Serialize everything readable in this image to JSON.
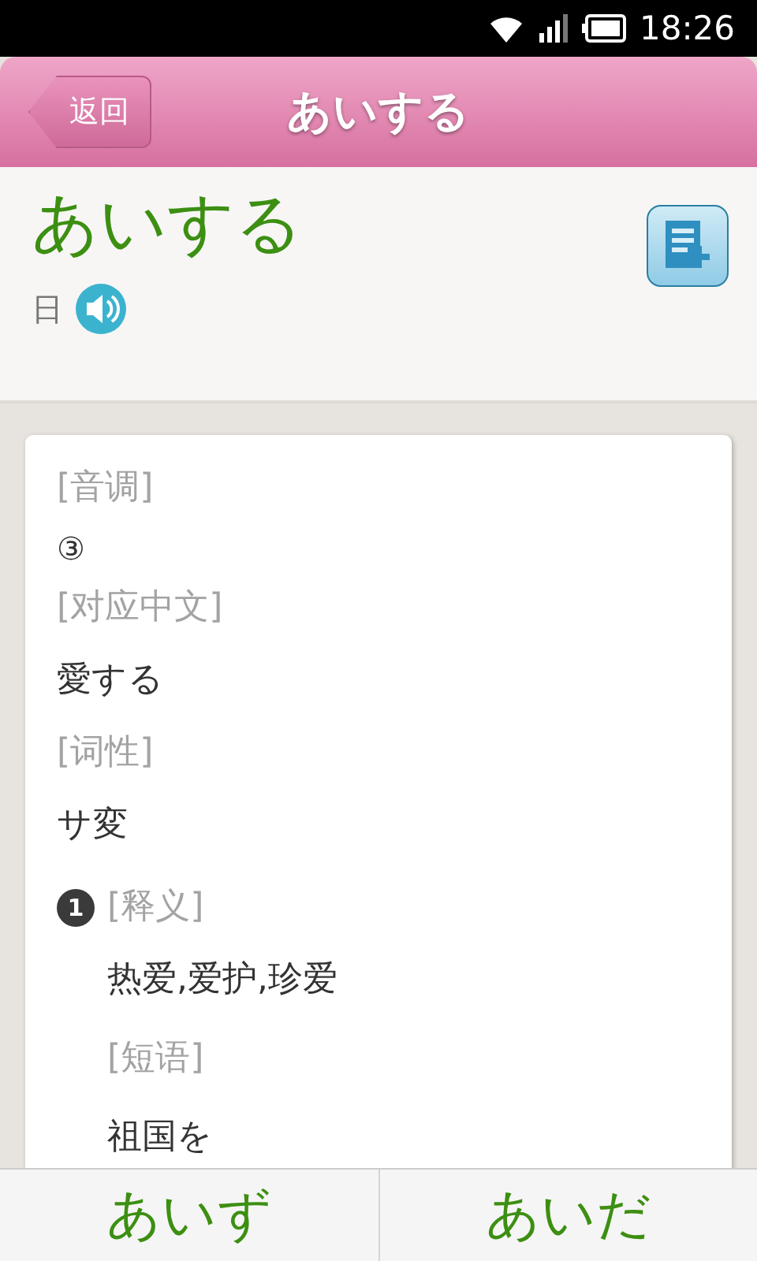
{
  "status_bar": {
    "time": "18:26"
  },
  "header": {
    "back": "返回",
    "title": "あいする"
  },
  "word": {
    "text": "あいする",
    "lang": "日"
  },
  "entries": [
    {
      "kind": "label",
      "text": "[音调]"
    },
    {
      "kind": "mark",
      "text": "③"
    },
    {
      "kind": "label",
      "text": "[对应中文]"
    },
    {
      "kind": "value",
      "text": "愛する"
    },
    {
      "kind": "label",
      "text": "[词性]"
    },
    {
      "kind": "value",
      "text": "サ変"
    },
    {
      "kind": "sense",
      "number": "1",
      "text": "[释义]",
      "items": [
        {
          "kind": "value",
          "text": "热爱,爱护,珍爱"
        },
        {
          "kind": "label",
          "text": "[短语]"
        },
        {
          "kind": "value",
          "text": "祖国を"
        }
      ]
    }
  ],
  "nav": [
    {
      "text": "あいず"
    },
    {
      "text": "あいだ"
    }
  ]
}
